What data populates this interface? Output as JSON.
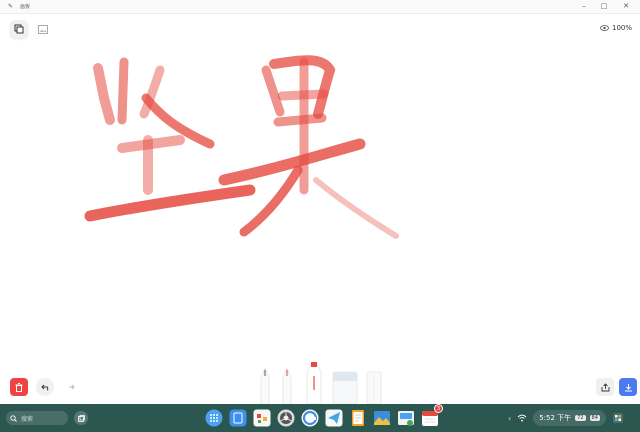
{
  "window": {
    "title": "画板"
  },
  "toolbar": {
    "zoom_label": "100%"
  },
  "canvas": {
    "handwriting_text": "坚果"
  },
  "taskbar": {
    "search_placeholder": "搜索",
    "dock_items": [
      "launcher",
      "file-manager",
      "notes",
      "chrome",
      "browser",
      "telegram",
      "pages",
      "gallery",
      "weather",
      "calendar"
    ],
    "calendar_badge": "3",
    "clock_time": "5:52 下午",
    "tray_chip_1": "72",
    "tray_chip_2": "84"
  },
  "colors": {
    "accent": "#4a7cf0",
    "ink": "#e54a3f",
    "delete": "#ee4444",
    "taskbar": "#2b5750"
  }
}
